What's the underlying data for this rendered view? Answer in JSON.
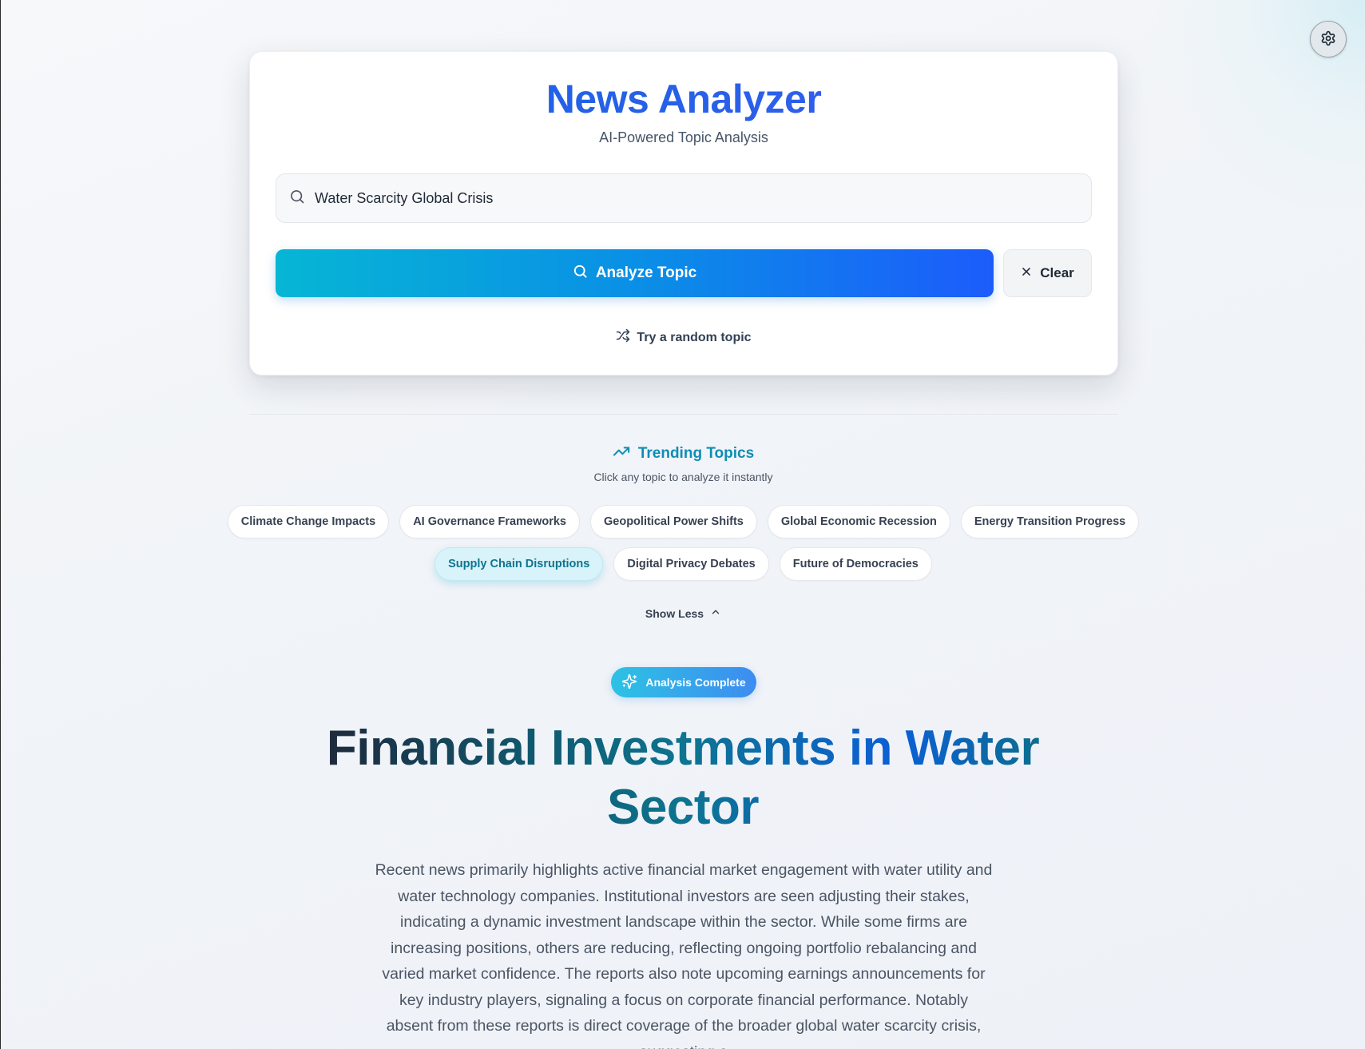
{
  "app": {
    "title": "News Analyzer",
    "subtitle": "AI-Powered Topic Analysis"
  },
  "search": {
    "value": "Water Scarcity Global Crisis",
    "icon": "search-icon"
  },
  "actions": {
    "analyze_label": "Analyze Topic",
    "clear_label": "Clear",
    "random_label": "Try a random topic"
  },
  "trending": {
    "title": "Trending Topics",
    "subtitle": "Click any topic to analyze it instantly",
    "topics": [
      "Climate Change Impacts",
      "AI Governance Frameworks",
      "Geopolitical Power Shifts",
      "Global Economic Recession",
      "Energy Transition Progress",
      "Supply Chain Disruptions",
      "Digital Privacy Debates",
      "Future of Democracies"
    ],
    "active_topic": "Supply Chain Disruptions",
    "toggle_label": "Show Less"
  },
  "result": {
    "badge": "Analysis Complete",
    "headline": "Financial Investments in Water Sector",
    "summary": "Recent news primarily highlights active financial market engagement with water utility and water technology companies. Institutional investors are seen adjusting their stakes, indicating a dynamic investment landscape within the sector. While some firms are increasing positions, others are reducing, reflecting ongoing portfolio rebalancing and varied market confidence. The reports also note upcoming earnings announcements for key industry players, signaling a focus on corporate financial performance. Notably absent from these reports is direct coverage of the broader global water scarcity crisis, suggesting a"
  },
  "colors": {
    "brand_blue": "#1565e0",
    "accent_cyan": "#06b6d4",
    "trending_teal": "#0e8db5"
  }
}
